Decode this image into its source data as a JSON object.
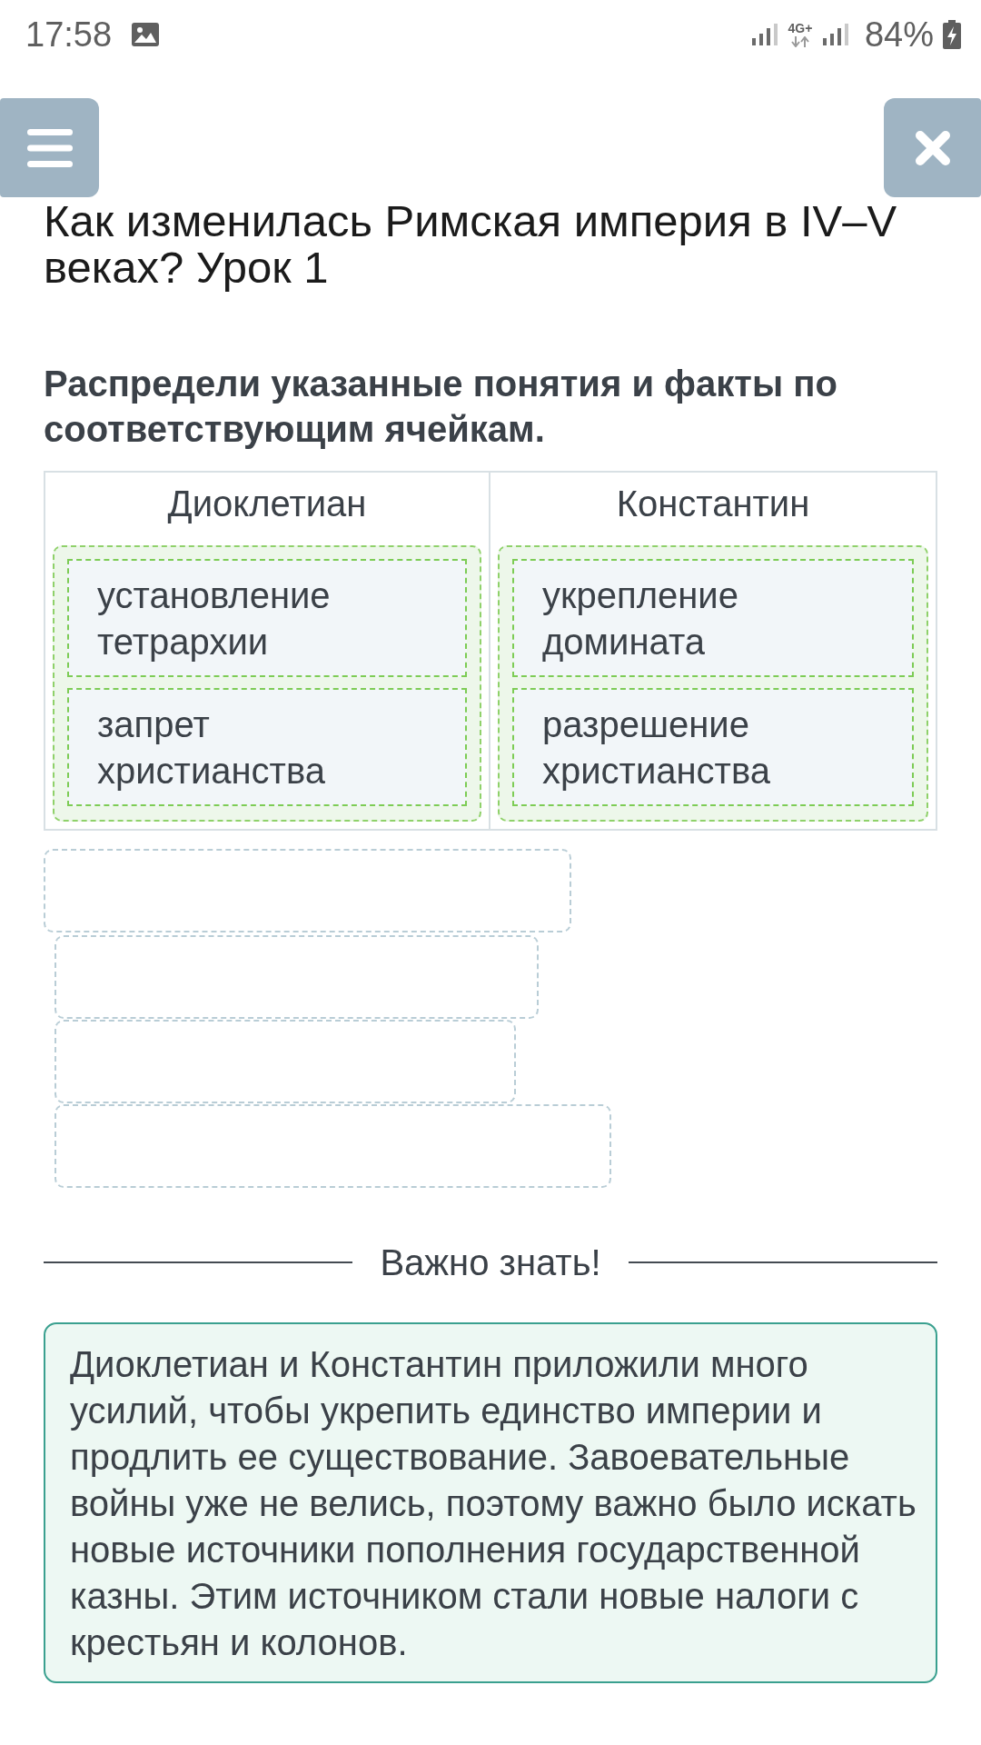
{
  "status_bar": {
    "time": "17:58",
    "network": "4G+",
    "battery": "84%"
  },
  "title": "Как изменилась Римская империя в IV–V веках? Урок 1",
  "task": {
    "instruction": "Распредели указанные понятия и факты по соответствующим ячейкам.",
    "columns": [
      {
        "heading": "Диоклетиан",
        "cards": [
          "установление тетрархии",
          "запрет христианства"
        ]
      },
      {
        "heading": "Константин",
        "cards": [
          "укрепление домината",
          "разрешение христианства"
        ]
      }
    ],
    "source_slots": [
      {
        "empty": true
      },
      {
        "empty": true
      },
      {
        "empty": true
      },
      {
        "empty": true
      }
    ]
  },
  "info": {
    "heading": "Важно знать!",
    "text": "Диоклетиан и Константин приложили много усилий, чтобы укрепить единство империи и продлить ее существование. Завоевательные войны уже не велись, поэтому важно было искать новые источники пополнения государственной казны. Этим источником стали новые налоги с крестьян и колонов."
  }
}
